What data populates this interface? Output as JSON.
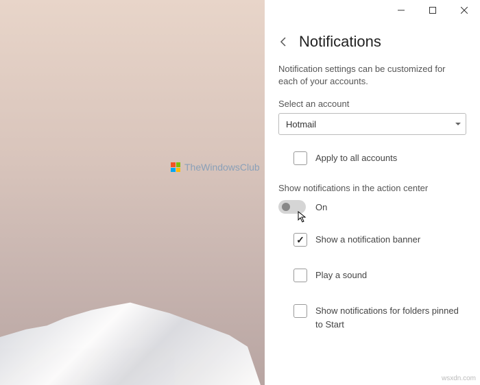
{
  "titlebar": {
    "minimize": "—",
    "maximize": "▢",
    "close": "✕"
  },
  "panel": {
    "title": "Notifications",
    "subtitle": "Notification settings can be customized for each of your accounts.",
    "select_label": "Select an account",
    "selected_account": "Hotmail",
    "apply_all": "Apply to all accounts",
    "section_label": "Show notifications in the action center",
    "toggle_state": "On",
    "options": {
      "banner": "Show a notification banner",
      "sound": "Play a sound",
      "folders": "Show notifications for folders pinned to Start"
    }
  },
  "watermark": "TheWindowsClub",
  "corner": "wsxdn.com"
}
